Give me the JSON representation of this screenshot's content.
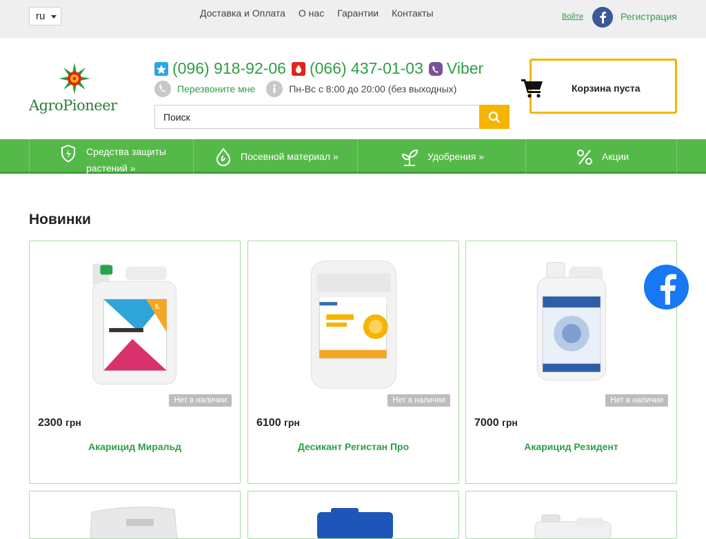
{
  "topbar": {
    "language": "ru",
    "nav": [
      "Доставка и Оплата",
      "О нас",
      "Гарантии",
      "Контакты"
    ],
    "login": "Войти",
    "register": "Регистрация"
  },
  "header": {
    "logo_text": "AgroPioneer",
    "phone_1": "(096) 918-92-06",
    "phone_2": "(066) 437-01-03",
    "viber": "Viber",
    "callback": "Перезвоните мне",
    "hours": "Пн-Вс с 8:00 до 20:00 (без выходных)",
    "search_placeholder": "Поиск",
    "cart_text": "Корзина пуста"
  },
  "categories": [
    {
      "label_line1": "Средства защиты",
      "label_line2": "растений »",
      "icon": "shield-icon"
    },
    {
      "label": "Посевной материал »",
      "icon": "seed-drop-icon"
    },
    {
      "label": "Удобрения »",
      "icon": "sprout-icon"
    },
    {
      "label": "Акции",
      "icon": "percent-icon"
    }
  ],
  "section_title": "Новинки",
  "products": [
    {
      "price": "2300",
      "currency": "грн",
      "name": "Акарицид Миральд",
      "status": "Нет в наличии"
    },
    {
      "price": "6100",
      "currency": "грн",
      "name": "Десикант Регистан Про",
      "status": "Нет в наличии"
    },
    {
      "price": "7000",
      "currency": "грн",
      "name": "Акарицид Резидент",
      "status": "Нет в наличии"
    }
  ],
  "colors": {
    "brand_green": "#55b949",
    "link_green": "#2e9e45",
    "accent_yellow": "#f5b400",
    "facebook": "#1877f2"
  }
}
